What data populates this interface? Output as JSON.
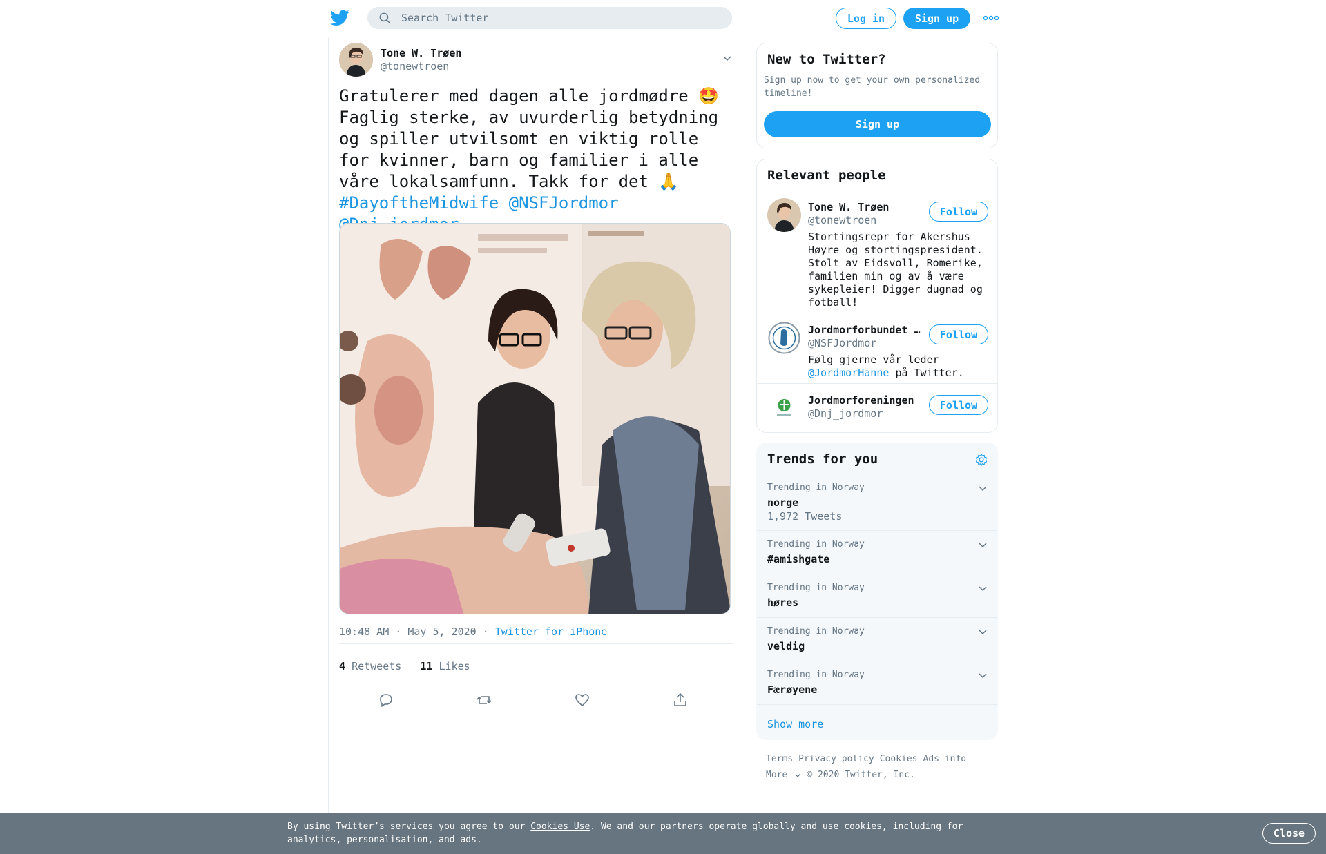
{
  "header": {
    "search_placeholder": "Search Twitter",
    "login_label": "Log in",
    "signup_label": "Sign up"
  },
  "tweet": {
    "author_name": "Tone W. Trøen",
    "author_handle": "@tonewtroen",
    "text_line1": "Gratulerer med dagen alle jordmødre ",
    "text_line1_emoji": "🤩",
    "text_body": "Faglig sterke, av uvurderlig betydning og spiller utvilsomt en viktig rolle for kvinner, barn og familier i alle våre lokalsamfunn. Takk for det ",
    "text_body_emoji": "🙏",
    "hashtag": "#DayoftheMidwife",
    "mention1": "@NSFJordmor",
    "mention2": "@Dnj_jordmor",
    "timestamp": "10:48 AM · May 5, 2020",
    "dot": "·",
    "source": "Twitter for iPhone",
    "retweets_count": "4",
    "retweets_label": "Retweets",
    "likes_count": "11",
    "likes_label": "Likes"
  },
  "signup_card": {
    "title": "New to Twitter?",
    "description": "Sign up now to get your own personalized timeline!",
    "button_label": "Sign up"
  },
  "relevant_people": {
    "title": "Relevant people",
    "follow_label": "Follow",
    "people": [
      {
        "name": "Tone W. Trøen",
        "handle": "@tonewtroen",
        "bio": "Stortingsrepr for Akershus Høyre og stortingspresident. Stolt av Eidsvoll, Romerike, familien min og av å være sykepleier! Digger dugnad og fotball!"
      },
      {
        "name": "Jordmorforbundet …",
        "handle": "@NSFJordmor",
        "bio_prefix": "Følg gjerne vår leder",
        "bio_link": "@JordmorHanne",
        "bio_suffix": "på Twitter."
      },
      {
        "name": "Jordmorforeningen",
        "handle": "@Dnj_jordmor"
      }
    ]
  },
  "trends": {
    "title": "Trends for you",
    "items": [
      {
        "context": "Trending in Norway",
        "name": "norge",
        "count": "1,972 Tweets"
      },
      {
        "context": "Trending in Norway",
        "name": "#amishgate"
      },
      {
        "context": "Trending in Norway",
        "name": "høres"
      },
      {
        "context": "Trending in Norway",
        "name": "veldig"
      },
      {
        "context": "Trending in Norway",
        "name": "Færøyene"
      }
    ],
    "show_more": "Show more"
  },
  "footer": {
    "links": [
      "Terms",
      "Privacy policy",
      "Cookies",
      "Ads info"
    ],
    "more": "More",
    "copyright": "© 2020 Twitter, Inc."
  },
  "cookie_bar": {
    "text_prefix": "By using Twitter’s services you agree to our",
    "link": "Cookies Use",
    "text_suffix": ". We and our partners operate globally and use cookies, including for analytics, personalisation, and ads.",
    "close_label": "Close"
  },
  "colors": {
    "brand_blue": "#1da1f2",
    "link_blue": "#1b95e0",
    "secondary_text": "#657786",
    "cookie_bar": "#66757f"
  }
}
